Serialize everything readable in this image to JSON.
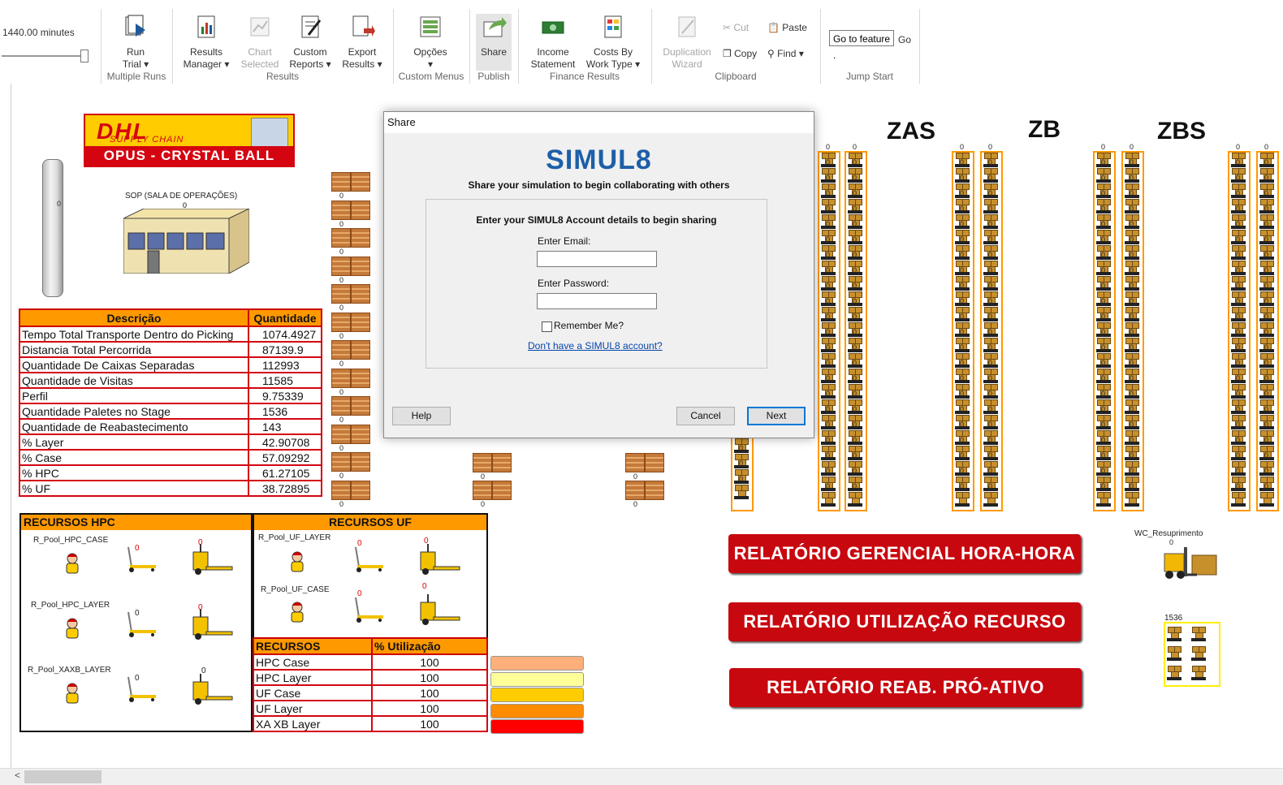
{
  "ribbon": {
    "slider_label": "1440.00 minutes",
    "run_trial": "Run\nTrial ▾",
    "multiple_runs_label": "Multiple Runs",
    "results_manager": "Results\nManager ▾",
    "chart_selected": "Chart\nSelected",
    "custom_reports": "Custom\nReports ▾",
    "export_results": "Export\nResults ▾",
    "results_label": "Results",
    "opcoes": "Opções\n▾",
    "custom_menus_label": "Custom Menus",
    "share": "Share",
    "publish_label": "Publish",
    "income_statement": "Income\nStatement",
    "costs_by_work_type": "Costs By\nWork Type ▾",
    "finance_label": "Finance Results",
    "duplication_wizard": "Duplication\nWizard",
    "cut": "Cut",
    "copy": "Copy",
    "paste": "Paste",
    "find": "Find ▾",
    "clipboard_label": "Clipboard",
    "jump_input_value": "Go to feature .",
    "jump_go": "Go",
    "jump_start_label": "Jump Start"
  },
  "logo": {
    "brand": "DHL",
    "tagline": "SUPPLY CHAIN",
    "banner": "OPUS - CRYSTAL BALL"
  },
  "tube_value": "0",
  "sop": {
    "label": "SOP (SALA DE OPERAÇÕES)",
    "value": "0"
  },
  "desc_table": {
    "headers": [
      "Descrição",
      "Quantidade"
    ],
    "rows": [
      [
        "Tempo Total Transporte Dentro do Picking",
        "1074.4927"
      ],
      [
        "Distancia Total Percorrida",
        "87139.9"
      ],
      [
        "Quantidade De Caixas Separadas",
        "112993"
      ],
      [
        "Quantidade de Visitas",
        "11585"
      ],
      [
        "Perfil",
        "9.75339"
      ],
      [
        "Quantidade Paletes no Stage",
        "1536"
      ],
      [
        "Quantidade de Reabastecimento",
        "143"
      ],
      [
        "% Layer",
        "42.90708"
      ],
      [
        "% Case",
        "57.09292"
      ],
      [
        "% HPC",
        "61.27105"
      ],
      [
        "% UF",
        "38.72895"
      ]
    ]
  },
  "resources_hpc": {
    "title": "RECURSOS HPC",
    "pools": [
      "R_Pool_HPC_CASE",
      "R_Pool_HPC_LAYER",
      "R_Pool_XAXB_LAYER"
    ]
  },
  "resources_uf": {
    "title": "RECURSOS UF",
    "pools": [
      "R_Pool_UF_LAYER",
      "R_Pool_UF_CASE"
    ]
  },
  "zero": "0",
  "util_table": {
    "headers": [
      "RECURSOS",
      "% Utilização"
    ],
    "rows": [
      [
        "HPC Case",
        "100"
      ],
      [
        "HPC Layer",
        "100"
      ],
      [
        "UF Case",
        "100"
      ],
      [
        "UF Layer",
        "100"
      ],
      [
        "XA XB Layer",
        "100"
      ]
    ],
    "swatch_colors": [
      "#ffb07a",
      "#ffff99",
      "#ffcc00",
      "#ff8c00",
      "#ff0000"
    ]
  },
  "zones": [
    "ZAS",
    "ZB",
    "ZBS"
  ],
  "report_buttons": [
    "RELATÓRIO GERENCIAL HORA-HORA",
    "RELATÓRIO UTILIZAÇÃO RECURSO",
    "RELATÓRIO REAB. PRÓ-ATIVO"
  ],
  "wc_label": "WC_Resuprimento",
  "wc_value": "0",
  "stage_value": "1536",
  "dialog": {
    "title": "Share",
    "brand": "SIMUL8",
    "subtitle": "Share your simulation to begin collaborating with others",
    "inner_title": "Enter your SIMUL8 Account details to begin sharing",
    "email_label": "Enter Email:",
    "email_value": "",
    "password_label": "Enter Password:",
    "password_value": "",
    "remember_label": "Remember Me?",
    "account_link": "Don't have a SIMUL8 account?",
    "help": "Help",
    "cancel": "Cancel",
    "next": "Next"
  }
}
